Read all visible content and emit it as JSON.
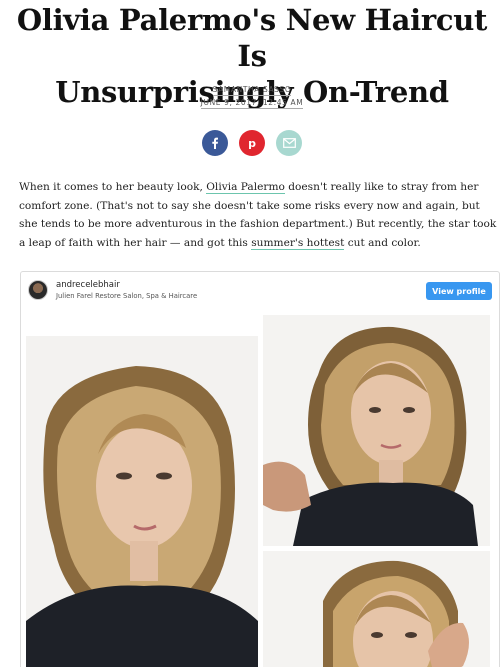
{
  "article": {
    "title_line1": "Olivia Palermo's New Haircut Is",
    "title_line2": "Unsurprisingly On-Trend",
    "author": "SAMANTHA SASSO",
    "date": "JUNE 9, 2017, 12:45 AM"
  },
  "share": {
    "icons": [
      "facebook-icon",
      "pinterest-icon",
      "email-icon"
    ],
    "colors": {
      "facebook": "#3b5998",
      "pinterest": "#e0262f",
      "email": "#a8d8d0"
    }
  },
  "body": {
    "p1": "When it comes to her beauty look, ",
    "link1": "Olivia Palermo",
    "p2": " doesn't really like to stray from her comfort zone. (That's not to say she doesn't take some risks every now and again, but she tends to be more adventurous in the fashion department.) But recently, the star took a leap of faith with her hair — and got this ",
    "link2": "summer's hottest",
    "p3": " cut and color."
  },
  "instagram": {
    "username": "andrecelebhair",
    "location": "Julien Farel Restore Salon, Spa & Haircare",
    "view_profile": "View profile",
    "button_color": "#3897f0"
  }
}
